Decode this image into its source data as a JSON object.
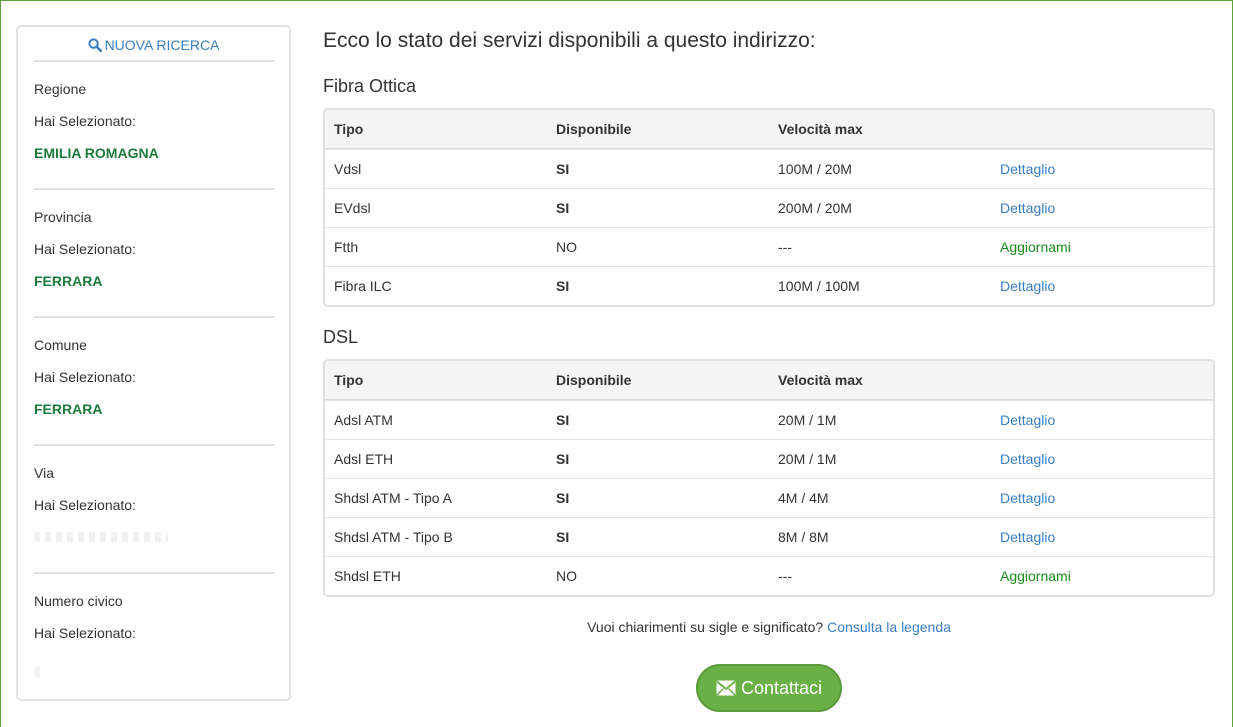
{
  "sidebar": {
    "new_search_label": "NUOVA RICERCA",
    "sections": [
      {
        "label": "Regione",
        "selected_prefix": "Hai Selezionato:",
        "value": "EMILIA ROMAGNA"
      },
      {
        "label": "Provincia",
        "selected_prefix": "Hai Selezionato:",
        "value": "FERRARA"
      },
      {
        "label": "Comune",
        "selected_prefix": "Hai Selezionato:",
        "value": "FERRARA"
      },
      {
        "label": "Via",
        "selected_prefix": "Hai Selezionato:"
      },
      {
        "label": "Numero civico",
        "selected_prefix": "Hai Selezionato:"
      }
    ]
  },
  "main": {
    "title": "Ecco lo stato dei servizi disponibili a questo indirizzo:",
    "columns": {
      "type": "Tipo",
      "available": "Disponibile",
      "speed": "Velocità max"
    },
    "groups": [
      {
        "name": "Fibra Ottica",
        "rows": [
          {
            "type": "Vdsl",
            "available": "SI",
            "speed": "100M / 20M",
            "action": "Dettaglio"
          },
          {
            "type": "EVdsl",
            "available": "SI",
            "speed": "200M / 20M",
            "action": "Dettaglio"
          },
          {
            "type": "Ftth",
            "available": "NO",
            "speed": "---",
            "action": "Aggiornami"
          },
          {
            "type": "Fibra ILC",
            "available": "SI",
            "speed": "100M / 100M",
            "action": "Dettaglio"
          }
        ]
      },
      {
        "name": "DSL",
        "rows": [
          {
            "type": "Adsl ATM",
            "available": "SI",
            "speed": "20M / 1M",
            "action": "Dettaglio"
          },
          {
            "type": "Adsl ETH",
            "available": "SI",
            "speed": "20M / 1M",
            "action": "Dettaglio"
          },
          {
            "type": "Shdsl ATM - Tipo A",
            "available": "SI",
            "speed": "4M / 4M",
            "action": "Dettaglio"
          },
          {
            "type": "Shdsl ATM - Tipo B",
            "available": "SI",
            "speed": "8M / 8M",
            "action": "Dettaglio"
          },
          {
            "type": "Shdsl ETH",
            "available": "NO",
            "speed": "---",
            "action": "Aggiornami"
          }
        ]
      }
    ],
    "legend_text": "Vuoi chiarimenti su sigle e significato?",
    "legend_link": "Consulta la legenda",
    "contact_label": "Contattaci"
  },
  "colors": {
    "frame": "#5ea23a",
    "link": "#3a7ec4",
    "selected_value": "#1e7a3c",
    "update_link": "#1a8c1a",
    "contact_button": "#69b046"
  },
  "icons": {
    "search": "search-icon",
    "envelope": "envelope-icon"
  }
}
